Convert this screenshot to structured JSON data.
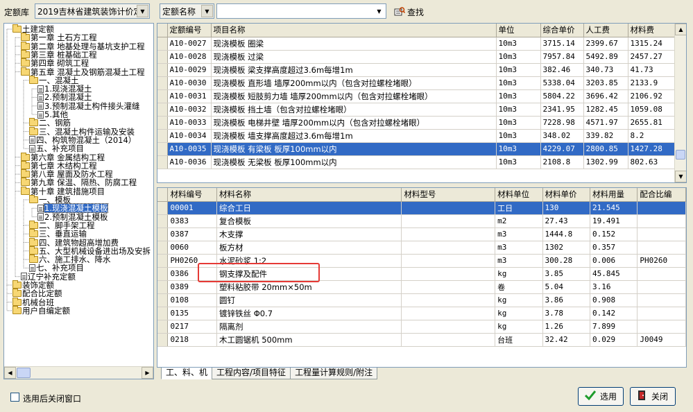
{
  "toolbar": {
    "library_label": "定额库",
    "library_value": "2019吉林省建筑装饰计价定",
    "field_value": "定额名称",
    "search_value": "",
    "find_label": "查找"
  },
  "tree": [
    {
      "t": "土建定额",
      "lv": 0,
      "icon": "folder"
    },
    {
      "t": "第一章 土石方工程",
      "lv": 1,
      "icon": "folder"
    },
    {
      "t": "第二章 地基处理与基坑支护工程",
      "lv": 1,
      "icon": "folder"
    },
    {
      "t": "第三章 桩基础工程",
      "lv": 1,
      "icon": "folder"
    },
    {
      "t": "第四章 砌筑工程",
      "lv": 1,
      "icon": "folder"
    },
    {
      "t": "第五章 混凝土及钢筋混凝土工程",
      "lv": 1,
      "icon": "folder"
    },
    {
      "t": "一、混凝土",
      "lv": 2,
      "icon": "folder"
    },
    {
      "t": "1.现浇混凝土",
      "lv": 3,
      "icon": "doc"
    },
    {
      "t": "2.预制混凝土",
      "lv": 3,
      "icon": "doc"
    },
    {
      "t": "3.预制混凝土构件接头灌缝",
      "lv": 3,
      "icon": "doc"
    },
    {
      "t": "5.其他",
      "lv": 3,
      "icon": "doc"
    },
    {
      "t": "二、钢筋",
      "lv": 2,
      "icon": "folder"
    },
    {
      "t": "三、混凝土构件运输及安装",
      "lv": 2,
      "icon": "folder"
    },
    {
      "t": "四、构筑物混凝土（2014）",
      "lv": 2,
      "icon": "doc"
    },
    {
      "t": "五、补充项目",
      "lv": 2,
      "icon": "doc"
    },
    {
      "t": "第六章 金属结构工程",
      "lv": 1,
      "icon": "folder"
    },
    {
      "t": "第七章 木结构工程",
      "lv": 1,
      "icon": "folder"
    },
    {
      "t": "第八章 屋面及防水工程",
      "lv": 1,
      "icon": "folder"
    },
    {
      "t": "第九章 保温、隔热、防腐工程",
      "lv": 1,
      "icon": "folder"
    },
    {
      "t": "第十章 建筑措施项目",
      "lv": 1,
      "icon": "folder"
    },
    {
      "t": "一、模板",
      "lv": 2,
      "icon": "folder"
    },
    {
      "t": "1.现浇混凝土模板",
      "lv": 3,
      "icon": "doc",
      "sel": true
    },
    {
      "t": "2.预制混凝土模板",
      "lv": 3,
      "icon": "doc"
    },
    {
      "t": "二、脚手架工程",
      "lv": 2,
      "icon": "folder"
    },
    {
      "t": "三、垂直运输",
      "lv": 2,
      "icon": "folder"
    },
    {
      "t": "四、建筑物超高增加费",
      "lv": 2,
      "icon": "folder"
    },
    {
      "t": "五、大型机械设备进出场及安拆",
      "lv": 2,
      "icon": "folder"
    },
    {
      "t": "六、施工排水、降水",
      "lv": 2,
      "icon": "folder"
    },
    {
      "t": "七、补充项目",
      "lv": 2,
      "icon": "doc"
    },
    {
      "t": "辽宁补充定额",
      "lv": 1,
      "icon": "doc"
    },
    {
      "t": "装饰定额",
      "lv": 0,
      "icon": "folder"
    },
    {
      "t": "配合比定额",
      "lv": 0,
      "icon": "folder"
    },
    {
      "t": "机械台班",
      "lv": 0,
      "icon": "folder"
    },
    {
      "t": "用户自编定额",
      "lv": 0,
      "icon": "folder"
    }
  ],
  "quota_table": {
    "headers": [
      "定额编号",
      "项目名称",
      "单位",
      "综合单价",
      "人工费",
      "材料费"
    ],
    "rows": [
      [
        "A10-0027",
        "现浇模板 圈梁",
        "10m3",
        "3715.14",
        "2399.67",
        "1315.24"
      ],
      [
        "A10-0028",
        "现浇模板 过梁",
        "10m3",
        "7957.84",
        "5492.89",
        "2457.27"
      ],
      [
        "A10-0029",
        "现浇模板 梁支撑高度超过3.6m每增1m",
        "10m3",
        "382.46",
        "340.73",
        "41.73"
      ],
      [
        "A10-0030",
        "现浇模板 直形墙 墙厚200mm以内（包含对拉螺栓堵眼）",
        "10m3",
        "5338.04",
        "3203.85",
        "2133.9"
      ],
      [
        "A10-0031",
        "现浇模板 短肢剪力墙 墙厚200mm以内（包含对拉螺栓堵眼）",
        "10m3",
        "5804.22",
        "3696.42",
        "2106.92"
      ],
      [
        "A10-0032",
        "现浇模板 挡土墙（包含对拉螺栓堵眼）",
        "10m3",
        "2341.95",
        "1282.45",
        "1059.08"
      ],
      [
        "A10-0033",
        "现浇模板 电梯井壁 墙厚200mm以内（包含对拉螺栓堵眼）",
        "10m3",
        "7228.98",
        "4571.97",
        "2655.81"
      ],
      [
        "A10-0034",
        "现浇模板 墙支撑高度超过3.6m每增1m",
        "10m3",
        "348.02",
        "339.82",
        "8.2"
      ],
      [
        "A10-0035",
        "现浇模板 有梁板 板厚100mm以内",
        "10m3",
        "4229.07",
        "2800.85",
        "1427.28"
      ],
      [
        "A10-0036",
        "现浇模板 无梁板 板厚100mm以内",
        "10m3",
        "2108.8",
        "1302.99",
        "802.63"
      ]
    ],
    "selected": 8
  },
  "material_table": {
    "headers": [
      "材料编号",
      "材料名称",
      "材料型号",
      "材料单位",
      "材料单价",
      "材料用量",
      "配合比编"
    ],
    "rows": [
      [
        "00001",
        "综合工日",
        "",
        "工日",
        "130",
        "21.545",
        ""
      ],
      [
        "0383",
        "复合模板",
        "",
        "m2",
        "27.43",
        "19.491",
        ""
      ],
      [
        "0387",
        "木支撑",
        "",
        "m3",
        "1444.8",
        "0.152",
        ""
      ],
      [
        "0060",
        "板方材",
        "",
        "m3",
        "1302",
        "0.357",
        ""
      ],
      [
        "PH0260",
        "水泥砂浆 1:2",
        "",
        "m3",
        "300.28",
        "0.006",
        "PH0260"
      ],
      [
        "0386",
        "钢支撑及配件",
        "",
        "kg",
        "3.85",
        "45.845",
        ""
      ],
      [
        "0389",
        "塑料粘胶带 20mm×50m",
        "",
        "卷",
        "5.04",
        "3.16",
        ""
      ],
      [
        "0108",
        "圆钉",
        "",
        "kg",
        "3.86",
        "0.908",
        ""
      ],
      [
        "0135",
        "镀锌铁丝 Φ0.7",
        "",
        "kg",
        "3.78",
        "0.142",
        ""
      ],
      [
        "0217",
        "隔离剂",
        "",
        "kg",
        "1.26",
        "7.899",
        ""
      ],
      [
        "0218",
        "木工圆锯机 500mm",
        "",
        "台班",
        "32.42",
        "0.029",
        "J0049"
      ]
    ],
    "selected": 0
  },
  "tabs": [
    "工、料、机",
    "工程内容/项目特征",
    "工程量计算规则/附注"
  ],
  "footer": {
    "close_after_select": "选用后关闭窗口",
    "select_button": "选用",
    "close_button": "关闭"
  },
  "colors": {
    "selection": "#316ac5",
    "highlight_box": "#e53935"
  }
}
